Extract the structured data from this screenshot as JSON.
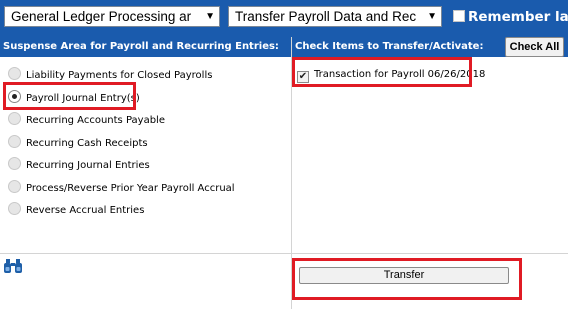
{
  "toolbar": {
    "module_select": "General Ledger Processing ar",
    "action_select": "Transfer Payroll Data and Rec",
    "remember_label": "Remember las"
  },
  "left_panel": {
    "header": "Suspense Area for Payroll and Recurring Entries:",
    "options": [
      {
        "label": "Liability Payments for Closed Payrolls",
        "selected": false
      },
      {
        "label": "Payroll Journal Entry(s)",
        "selected": true
      },
      {
        "label": "Recurring Accounts Payable",
        "selected": false
      },
      {
        "label": "Recurring Cash Receipts",
        "selected": false
      },
      {
        "label": "Recurring Journal Entries",
        "selected": false
      },
      {
        "label": "Process/Reverse Prior Year Payroll Accrual",
        "selected": false
      },
      {
        "label": "Reverse Accrual Entries",
        "selected": false
      }
    ]
  },
  "right_panel": {
    "header": "Check Items to Transfer/Activate:",
    "check_all_label": "Check All",
    "items": [
      {
        "label": "Transaction for Payroll 06/26/2018",
        "checked": true
      }
    ]
  },
  "footer": {
    "transfer_label": "Transfer",
    "search_icon": "binoculars-icon"
  },
  "colors": {
    "header_bg": "#1a5bad",
    "highlight": "#e01b24"
  }
}
